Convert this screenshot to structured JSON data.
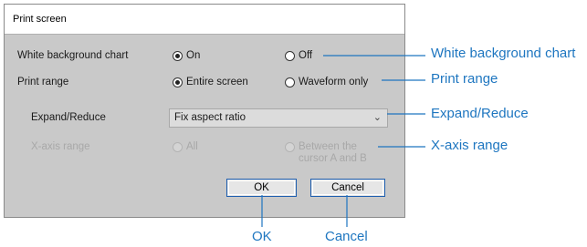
{
  "dialog": {
    "title": "Print screen",
    "rows": {
      "white_bg": {
        "label": "White background chart",
        "on": "On",
        "off": "Off",
        "selected": "On"
      },
      "print_range": {
        "label": "Print range",
        "entire": "Entire screen",
        "waveform": "Waveform only",
        "selected": "Entire screen"
      },
      "expand_reduce": {
        "label": "Expand/Reduce",
        "value": "Fix aspect ratio"
      },
      "x_axis": {
        "label": "X-axis range",
        "all": "All",
        "between_line1": "Between the",
        "between_line2": "cursor A and B",
        "enabled": false
      }
    },
    "buttons": {
      "ok": "OK",
      "cancel": "Cancel"
    }
  },
  "callouts": {
    "white_bg": "White background chart",
    "print_range": "Print range",
    "expand_reduce": "Expand/Reduce",
    "x_axis": "X-axis range",
    "ok": "OK",
    "cancel": "Cancel"
  },
  "colors": {
    "callout": "#1e76c0",
    "dialog_bg": "#c9c9c9",
    "button_border": "#1f5fb0"
  }
}
